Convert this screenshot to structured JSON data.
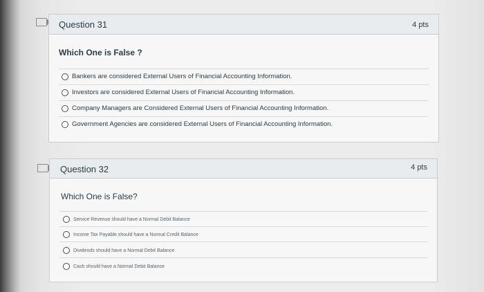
{
  "q1": {
    "title": "Question 31",
    "points": "4 pts",
    "prompt": "Which One is False ?",
    "answers": [
      "Bankers are considered External Users of Financial Accounting Information.",
      "Investors are considered External Users of Financial Accounting Information.",
      "Company Managers are Considered External Users of Financial Accounting Information.",
      "Government Agencies are considered External Users of Financial Accounting Information."
    ]
  },
  "q2": {
    "title": "Question 32",
    "points": "4 pts",
    "prompt": "Which One is False?",
    "answers": [
      "Service Revenue should have a Normal Debit Balance",
      "Income Tax Payable should have a Normal Credit Balance",
      "Dividends should have a Normal Debit Balance",
      "Cash should have a Normal Debit Balance"
    ]
  },
  "icons": {
    "flag": "flag-question-icon"
  }
}
